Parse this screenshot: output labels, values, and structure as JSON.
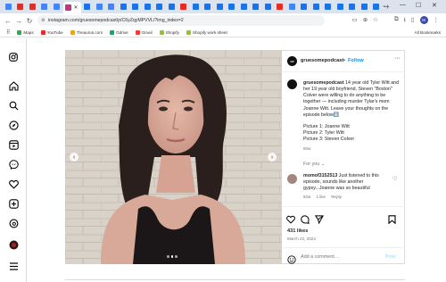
{
  "browser": {
    "tabs": [
      {
        "type": "g",
        "color": "#4285f4"
      },
      {
        "type": "yt",
        "color": "#e52d27"
      },
      {
        "type": "yt",
        "color": "#e52d27"
      },
      {
        "type": "g",
        "color": "#4285f4"
      },
      {
        "type": "g",
        "color": "#4285f4"
      },
      {
        "type": "ig",
        "color": "#c13584"
      },
      {
        "type": "w",
        "color": "#1a73e8"
      },
      {
        "type": "g",
        "color": "#4285f4"
      },
      {
        "type": "g",
        "color": "#4285f4"
      },
      {
        "type": "w",
        "color": "#1a73e8"
      },
      {
        "type": "w",
        "color": "#1a73e8"
      },
      {
        "type": "w",
        "color": "#1a73e8"
      },
      {
        "type": "w",
        "color": "#1a73e8"
      },
      {
        "type": "w",
        "color": "#1a73e8"
      },
      {
        "type": "yt",
        "color": "#e52d27"
      },
      {
        "type": "w",
        "color": "#1a73e8"
      },
      {
        "type": "w",
        "color": "#1a73e8"
      },
      {
        "type": "w",
        "color": "#1a73e8"
      },
      {
        "type": "w",
        "color": "#1a73e8"
      },
      {
        "type": "w",
        "color": "#1a73e8"
      },
      {
        "type": "w",
        "color": "#1a73e8"
      },
      {
        "type": "w",
        "color": "#1a73e8"
      },
      {
        "type": "yt",
        "color": "#e52d27"
      },
      {
        "type": "g",
        "color": "#4285f4"
      },
      {
        "type": "w",
        "color": "#1a73e8"
      },
      {
        "type": "w",
        "color": "#1a73e8"
      },
      {
        "type": "w",
        "color": "#1a73e8"
      },
      {
        "type": "w",
        "color": "#1a73e8"
      },
      {
        "type": "w",
        "color": "#1a73e8"
      },
      {
        "type": "w",
        "color": "#1a73e8"
      },
      {
        "type": "w",
        "color": "#1a73e8"
      }
    ],
    "url": "instagram.com/gruesomepodcast/p/C6yZqyMPVVL/?img_index=2",
    "profile_initial": "M",
    "bookmarks": [
      {
        "label": "Maps",
        "color": "#34a853"
      },
      {
        "label": "YouTube",
        "color": "#e52d27"
      },
      {
        "label": "Theaurus.com",
        "color": "#f4a300"
      },
      {
        "label": "Gdrive",
        "color": "#1fa463"
      },
      {
        "label": "Gmail",
        "color": "#ea4335"
      },
      {
        "label": "Shopify",
        "color": "#95bf47"
      },
      {
        "label": "Shopify work sheet",
        "color": "#95bf47"
      }
    ],
    "all_bookmarks": "All Bookmarks"
  },
  "post": {
    "username": "gruesomepodcast",
    "follow": "Follow",
    "caption_user": "gruesomepodcast",
    "caption": "14 year old Tyler Witt and her 19 year old boyfriend, Steven \"Boston\" Colver were willing to do anything to be together — including murder Tylar's mom Joanne Witt. Leave your thoughts on the episode below⬇️",
    "pictures": [
      "Picture 1: Joanne Witt",
      "Picture 2: Tyler Witt",
      "Picture 3: Steven Colver"
    ],
    "caption_time": "60w",
    "for_you": "For you",
    "comment_user": "momof3152513",
    "comment_text": "Just listened to this episode, sounds like another gypsy...Joanne was so beautiful",
    "comment_time": "52w",
    "comment_likes": "1 like",
    "comment_reply": "Reply",
    "likes": "431 likes",
    "date": "March 22, 2024",
    "add_comment_placeholder": "Add a comment…",
    "post_btn": "Post"
  },
  "colors": {
    "follow_blue": "#0095f6",
    "muted": "#737373"
  }
}
